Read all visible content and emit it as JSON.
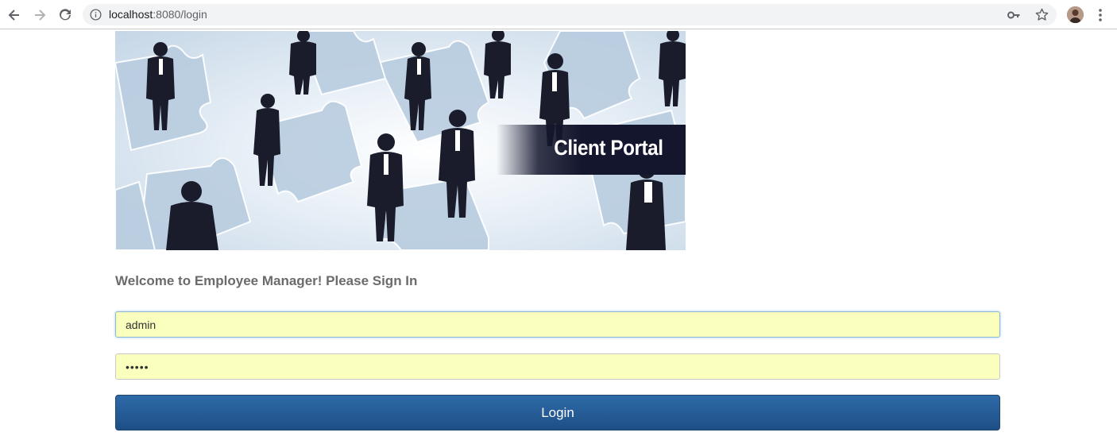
{
  "browser": {
    "url_host": "localhost",
    "url_rest": ":8080/login",
    "icons": {
      "back": "arrow-left-icon",
      "forward": "arrow-right-icon",
      "reload": "reload-icon",
      "info": "info-icon",
      "key": "key-icon",
      "star": "star-icon",
      "menu": "kebab-menu-icon"
    }
  },
  "hero": {
    "banner_text": "Client Portal"
  },
  "login": {
    "welcome": "Welcome to Employee Manager! Please Sign In",
    "username_value": "admin",
    "password_value": "•••••",
    "button_label": "Login"
  },
  "colors": {
    "autofill_bg": "#faffbd",
    "button_top": "#2e6aa8",
    "button_bottom": "#1e4f86",
    "banner_bg": "#14162e"
  }
}
